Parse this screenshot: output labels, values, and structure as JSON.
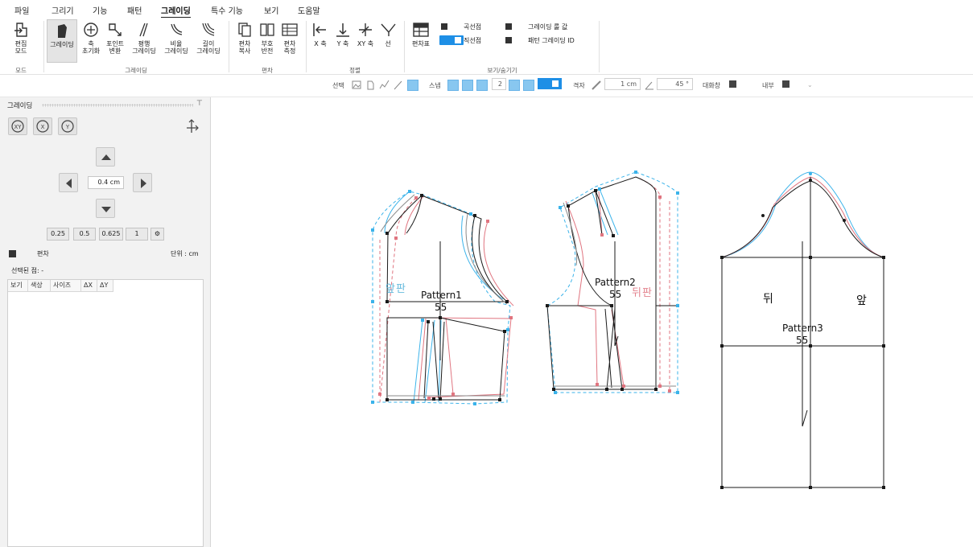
{
  "menu": [
    "파일",
    "그리기",
    "기능",
    "패턴",
    "그레이딩",
    "특수 기능",
    "보기",
    "도움말"
  ],
  "menu_active": "그레이딩",
  "ribbon": {
    "edit_mode": "편집\n모드",
    "group_mode": "모드",
    "grading": "그레이딩",
    "axis_reset": "축\n초기화",
    "point_convert": "포인트\n변환",
    "parallel": "평행\n그레이딩",
    "ratio": "비율\n그레이딩",
    "length": "길이\n그레이딩",
    "group_grading": "그레이딩",
    "piece_copy": "편차\n복사",
    "sign_flip": "부호\n반전",
    "piece_measure": "편차\n측정",
    "group_piece": "편차",
    "x_axis": "X 축",
    "y_axis": "Y 축",
    "xy_axis": "XY 축",
    "line": "선",
    "group_align": "정렬",
    "deviation_table": "편차표",
    "curve_point": "곡선점",
    "straight_point": "직선점",
    "grading_value": "그레이딩 룰 값",
    "pattern_grading_id": "패턴 그레이딩 ID",
    "group_view": "보기/숨기기"
  },
  "snapbar": {
    "select": "선택",
    "snap": "스냅",
    "snap_count": "2",
    "grid": "격자",
    "grid_value": "1 cm",
    "angle_value": "45 °",
    "dialog": "대화창",
    "inner": "내부"
  },
  "panel": {
    "title": "그레이딩",
    "step_value": "0.4 cm",
    "quick_values": [
      "0.25",
      "0.5",
      "0.625",
      "1"
    ],
    "piece_label": "편차",
    "unit": "단위 : cm",
    "selected_point": "선택된 점: -",
    "columns": [
      "보기",
      "색상",
      "사이즈",
      "ΔX",
      "ΔY"
    ]
  },
  "canvas": {
    "pattern1_name": "Pattern1",
    "pattern1_size": "55",
    "pattern1_mark": "앞판",
    "pattern2_name": "Pattern2",
    "pattern2_size": "55",
    "pattern2_mark": "뒤판",
    "pattern3_name": "Pattern3",
    "pattern3_size": "55",
    "back_label": "뒤",
    "front_label": "앞"
  },
  "colors": {
    "accent": "#1e8fe6",
    "grade_blue": "#29aee8",
    "grade_red": "#e0707a",
    "grade_gray": "#888888"
  }
}
